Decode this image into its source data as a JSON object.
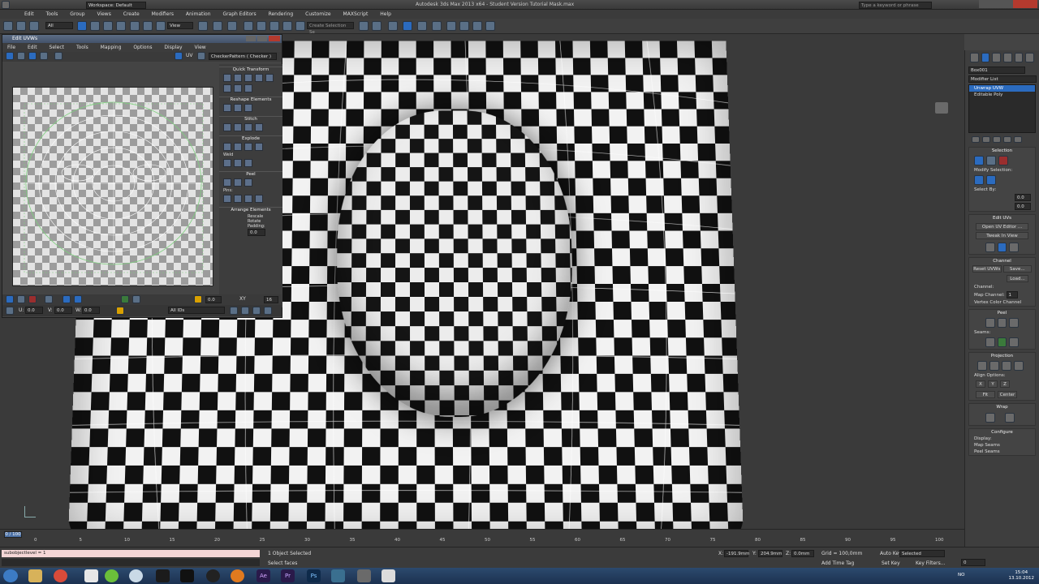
{
  "app": {
    "title": "Autodesk 3ds Max 2013 x64 - Student Version    Tutorial Mask.max",
    "workspace": "Workspace: Default",
    "search_placeholder": "Type a keyword or phrase"
  },
  "menu": [
    "Edit",
    "Tools",
    "Group",
    "Views",
    "Create",
    "Modifiers",
    "Animation",
    "Graph Editors",
    "Rendering",
    "Customize",
    "MAXScript",
    "Help"
  ],
  "toolbar": {
    "filter": "All",
    "ref_coord": "View",
    "named_sel": "Create Selection Se"
  },
  "uvw_editor": {
    "title": "Edit UVWs",
    "menu": [
      "File",
      "Edit",
      "Select",
      "Tools",
      "Mapping",
      "Options",
      "Display",
      "View"
    ],
    "uv_label": "UV",
    "texture_dropdown": "CheckerPattern ( Checker )",
    "rollouts": {
      "quick_transform": "Quick Transform",
      "reshape": "Reshape Elements",
      "stitch": "Stitch",
      "explode": "Explode",
      "weld": "Weld",
      "peel": "Peel",
      "pins": "Pins:",
      "arrange": "Arrange Elements",
      "rescale": "Rescale",
      "rotate": "Rotate",
      "padding": "Padding:",
      "padding_value": "0.0"
    },
    "bottom": {
      "u": "U:",
      "v": "V:",
      "w": "W:",
      "u_val": "0.0",
      "v_val": "0.0",
      "w_val": "0.0",
      "xy": "XY",
      "spin_val": "0.0",
      "spin_val2": "16",
      "allids": "All IDs"
    }
  },
  "command_panel": {
    "object_name": "Box001",
    "modifier_list": "Modifier List",
    "stack": [
      "Unwrap UVW",
      "Editable Poly"
    ],
    "selection": "Selection",
    "modify_selection": "Modify Selection:",
    "select_by": "Select By:",
    "select_by_val": "0.0",
    "select_by_val2": "0.0",
    "edit_uvs": "Edit UVs",
    "open_uv_editor": "Open UV Editor ...",
    "tweak_in_view": "Tweak In View",
    "channel": "Channel",
    "reset_uvws": "Reset UVWs",
    "save": "Save...",
    "load": "Load...",
    "channel_label": "Channel:",
    "map_channel": "Map Channel:",
    "map_channel_val": "1",
    "vertex_color_channel": "Vertex Color Channel",
    "peel": "Peel",
    "seams": "Seams:",
    "projection": "Projection",
    "align_options": "Align Options:",
    "align_x": "X",
    "align_y": "Y",
    "align_z": "Z",
    "fit": "Fit",
    "center": "Center",
    "wrap": "Wrap",
    "configure": "Configure",
    "display": "Display:",
    "map_seams": "Map Seams",
    "peel_seams": "Peel Seams"
  },
  "timeline": {
    "frame": "0 / 100",
    "ticks": [
      "0",
      "5",
      "10",
      "15",
      "20",
      "25",
      "30",
      "35",
      "40",
      "45",
      "50",
      "55",
      "60",
      "65",
      "70",
      "75",
      "80",
      "85",
      "90",
      "95",
      "100"
    ]
  },
  "status": {
    "maxscript": "subobjectlevel = 1",
    "selected": "1 Object Selected",
    "hint": "Select faces",
    "x": "X:",
    "x_val": "-191.9mm",
    "y": "Y:",
    "y_val": "204.9mm",
    "z": "Z:",
    "z_val": "0.0mm",
    "grid": "Grid = 100,0mm",
    "add_time_tag": "Add Time Tag",
    "auto_key": "Auto Key",
    "set_key": "Set Key",
    "key_mode": "Selected",
    "key_filters": "Key Filters...",
    "frame_val": "0"
  },
  "taskbar": {
    "apps": [
      "start",
      "explorer",
      "chrome",
      "spotify",
      "itunes",
      "media",
      "steam",
      "origin",
      "after-effects",
      "premiere",
      "photoshop",
      "3dsmax",
      "winamp",
      "other"
    ],
    "time": "15:04",
    "date": "13.10.2012",
    "lang": "NO"
  }
}
